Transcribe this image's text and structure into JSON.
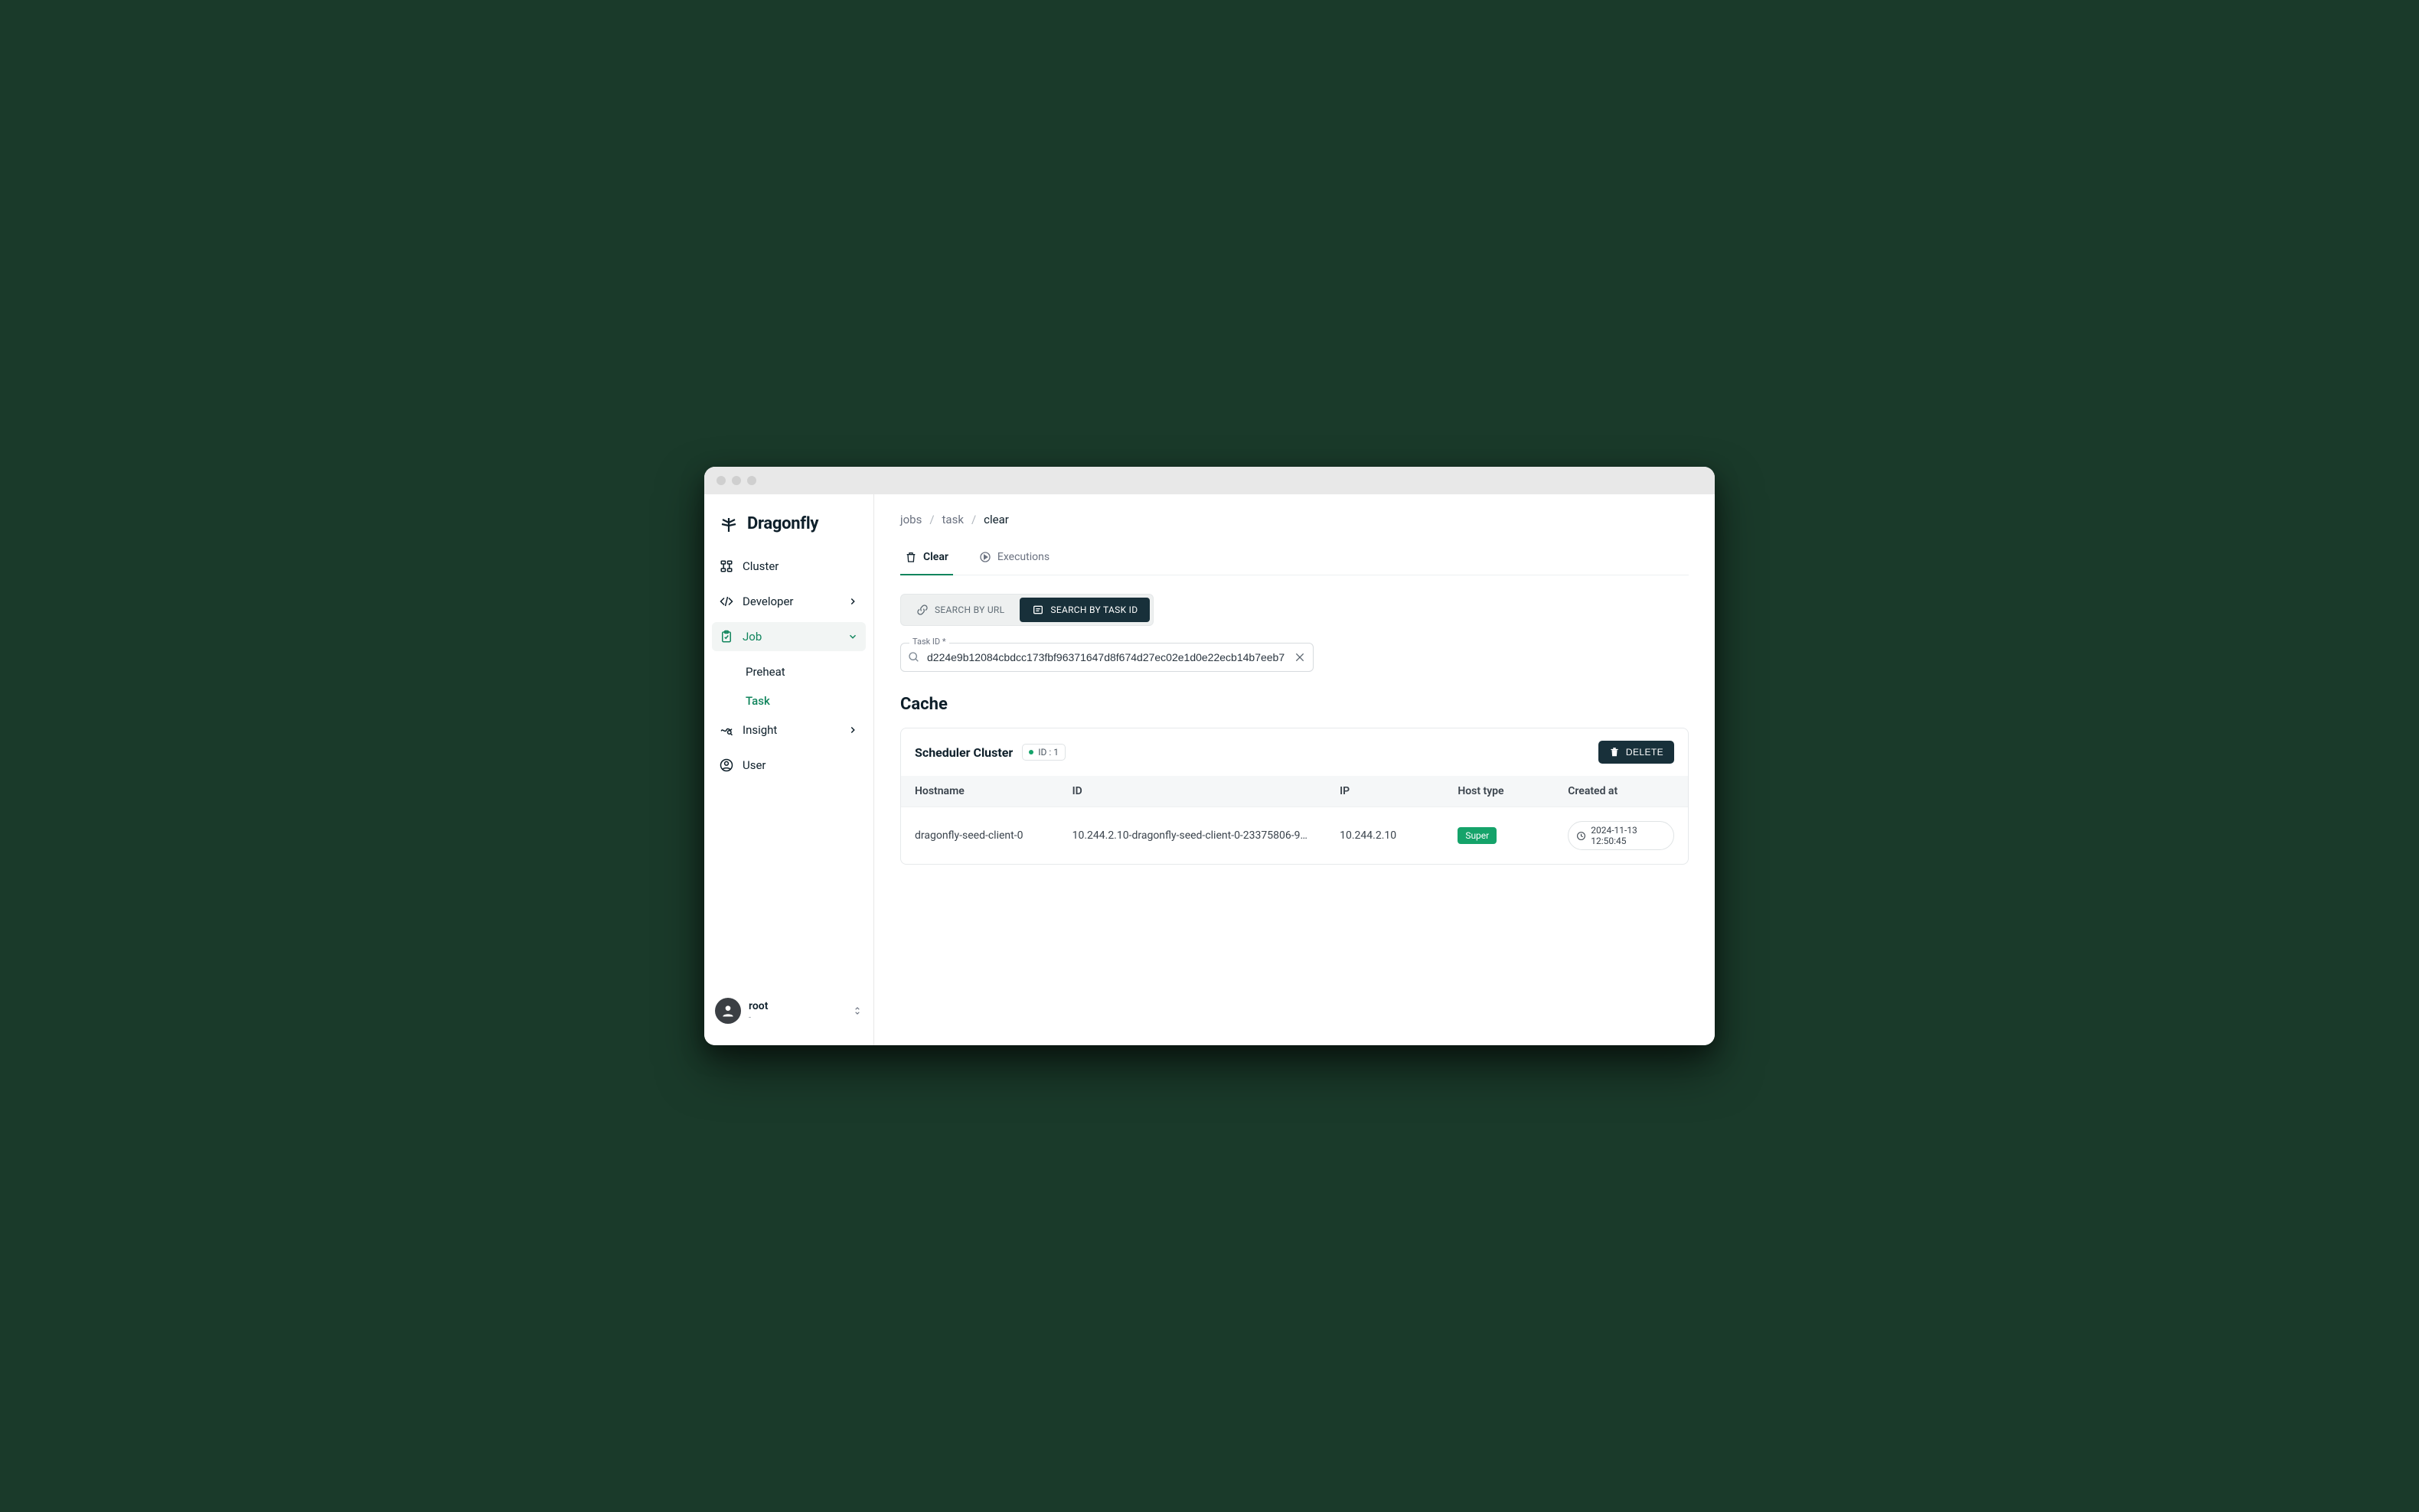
{
  "brand": {
    "name": "Dragonfly"
  },
  "sidebar": {
    "items": [
      {
        "label": "Cluster"
      },
      {
        "label": "Developer"
      },
      {
        "label": "Job"
      },
      {
        "label": "Insight"
      },
      {
        "label": "User"
      }
    ],
    "job_sub": [
      {
        "label": "Preheat"
      },
      {
        "label": "Task"
      }
    ]
  },
  "user": {
    "name": "root",
    "role": "-"
  },
  "breadcrumbs": {
    "a": "jobs",
    "b": "task",
    "c": "clear"
  },
  "tabs": {
    "clear": "Clear",
    "executions": "Executions"
  },
  "search_toggle": {
    "url": "SEARCH BY URL",
    "task": "SEARCH BY TASK ID"
  },
  "field": {
    "label": "Task ID *",
    "value": "d224e9b12084cbdcc173fbf96371647d8f674d27ec02e1d0e22ecb14b7eeb7"
  },
  "section": {
    "title": "Cache"
  },
  "cluster": {
    "name": "Scheduler Cluster",
    "id_label": "ID :  1",
    "delete": "DELETE"
  },
  "table": {
    "headers": {
      "hostname": "Hostname",
      "id": "ID",
      "ip": "IP",
      "host_type": "Host type",
      "created": "Created at"
    },
    "row": {
      "hostname": "dragonfly-seed-client-0",
      "id": "10.244.2.10-dragonfly-seed-client-0-23375806-9360-…",
      "ip": "10.244.2.10",
      "host_type": "Super",
      "created": "2024-11-13 12:50:45"
    }
  }
}
